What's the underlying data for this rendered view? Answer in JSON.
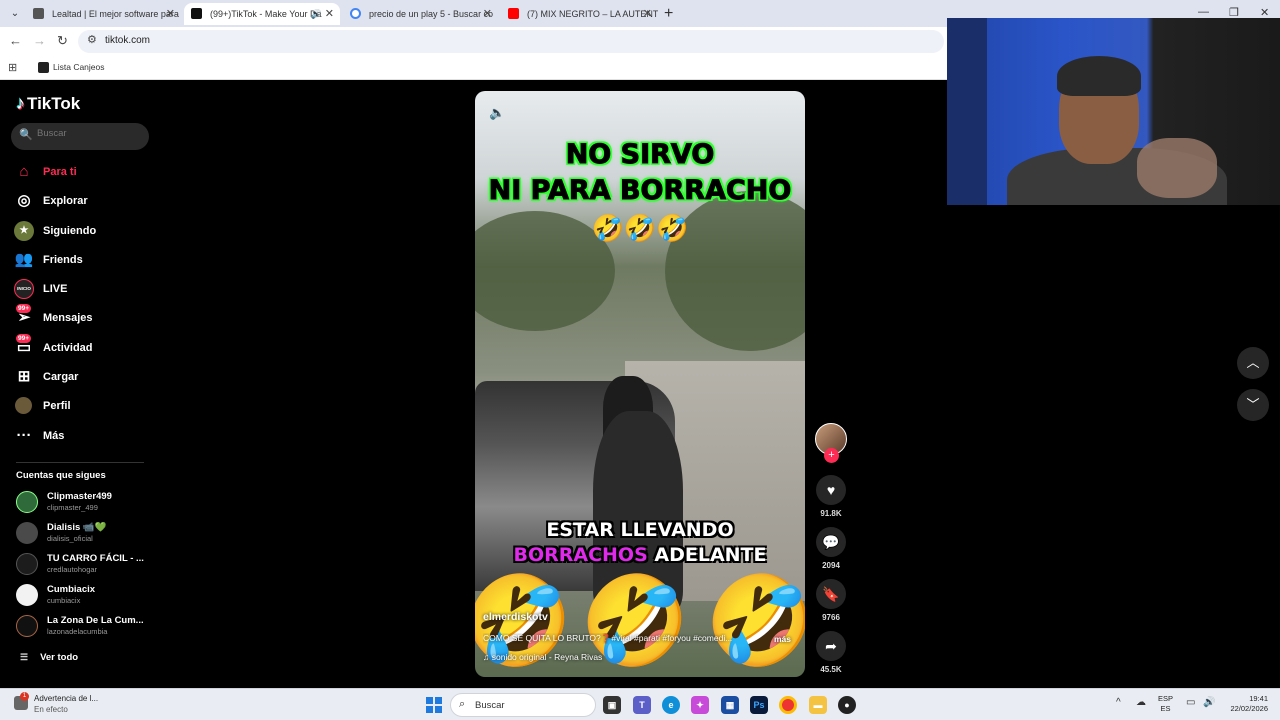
{
  "browser": {
    "tabs": [
      {
        "title": "Lealtad | El mejor software para",
        "active": false
      },
      {
        "title": "(99+)TikTok - Make Your Da",
        "active": true
      },
      {
        "title": "precio de un play 5 - Buscar co",
        "active": false
      },
      {
        "title": "(7) MIX NEGRITO – LA AUTENTI",
        "active": false
      }
    ],
    "url": "tiktok.com",
    "bookmark": "Lista Canjeos"
  },
  "tiktok": {
    "brand": "TikTok",
    "search_placeholder": "Buscar",
    "nav": [
      {
        "label": "Para ti",
        "icon": "home-icon",
        "active": true
      },
      {
        "label": "Explorar",
        "icon": "compass-icon"
      },
      {
        "label": "Siguiendo",
        "icon": "following-avatar-icon"
      },
      {
        "label": "Friends",
        "icon": "friends-icon"
      },
      {
        "label": "LIVE",
        "icon": "live-icon",
        "badge": "INICIO"
      },
      {
        "label": "Mensajes",
        "icon": "messages-icon",
        "badge": "99+"
      },
      {
        "label": "Actividad",
        "icon": "activity-icon",
        "badge": "99+"
      },
      {
        "label": "Cargar",
        "icon": "upload-icon"
      },
      {
        "label": "Perfil",
        "icon": "profile-avatar-icon"
      },
      {
        "label": "Más",
        "icon": "more-icon"
      }
    ],
    "following_title": "Cuentas que sigues",
    "following": [
      {
        "name": "Clipmaster499",
        "handle": "clipmaster_499",
        "color": "#2f6b3a"
      },
      {
        "name": "Dialisis 📹💚",
        "handle": "dialisis_oficial",
        "color": "#4a4a4a"
      },
      {
        "name": "TU CARRO FÁCIL - ...",
        "handle": "credlautohogar",
        "color": "#1c1c1c"
      },
      {
        "name": "Cumbiacix",
        "handle": "cumbiacix",
        "color": "#f2f2f2"
      },
      {
        "name": "La Zona De La Cum...",
        "handle": "lazonadelacumbia",
        "color": "#111111"
      }
    ],
    "see_all": "Ver todo",
    "video": {
      "caption_top_line1": "NO SIRVO",
      "caption_top_line2": "NI PARA BORRACHO",
      "emoji_row": "🤣🤣🤣",
      "caption_mid_line1": "ESTAR LLEVANDO",
      "caption_mid_pink": "BORRACHOS",
      "caption_mid_white": " ADELANTE",
      "author": "elmerdiskotv",
      "description": "COMO SE QUITA LO BRUTO?❓#viral #parati #foryou #comedi...",
      "more": "más",
      "sound": "♫  sonido original - Reyna Rivas"
    },
    "actions": {
      "likes": "91.8K",
      "comments": "2094",
      "saves": "9766",
      "shares": "45.5K"
    }
  },
  "taskbar": {
    "notification_title": "Advertencia de l...",
    "notification_status": "En efecto",
    "notification_count": "1",
    "search": "Buscar",
    "lang_top": "ESP",
    "lang_bottom": "ES",
    "time": "19:41",
    "date": "22/02/2026"
  }
}
